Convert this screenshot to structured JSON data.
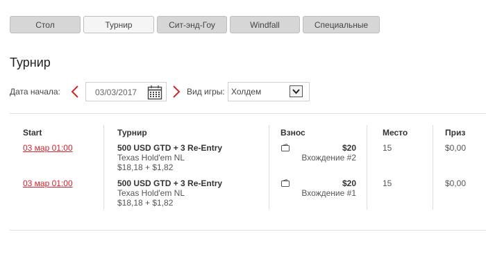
{
  "tabs": [
    {
      "label": "Стол"
    },
    {
      "label": "Турнир"
    },
    {
      "label": "Сит-энд-Гоу"
    },
    {
      "label": "Windfall"
    },
    {
      "label": "Специальные"
    }
  ],
  "page": {
    "title": "Турнир"
  },
  "filters": {
    "start_label": "Дата начала:",
    "date_value": "03/03/2017",
    "game_label": "Вид игры:",
    "game_value": "Холдем"
  },
  "table": {
    "headers": {
      "start": "Start",
      "tournament": "Турнир",
      "buyin": "Взнос",
      "place": "Место",
      "prize": "Приз"
    },
    "rows": [
      {
        "start": "03 мар 01:00",
        "name": "500 USD GTD + 3 Re-Entry",
        "game": "Texas Hold'em NL",
        "fee": "$18,18 + $1,82",
        "amount": "$20",
        "entry": "Вхождение #2",
        "place": "15",
        "prize": "$0,00"
      },
      {
        "start": "03 мар 01:00",
        "name": "500 USD GTD + 3 Re-Entry",
        "game": "Texas Hold'em NL",
        "fee": "$18,18 + $1,82",
        "amount": "$20",
        "entry": "Вхождение #1",
        "place": "15",
        "prize": "$0,00"
      }
    ]
  },
  "colors": {
    "accent": "#d6232b",
    "tab_bg": "#d6d6d6",
    "tab_active_bg": "#f5f5f5"
  },
  "icons": {
    "prev": "chevron-left-icon",
    "next": "chevron-right-icon",
    "calendar": "calendar-icon",
    "dropdown": "chevron-down-icon",
    "wallet": "wallet-icon"
  }
}
